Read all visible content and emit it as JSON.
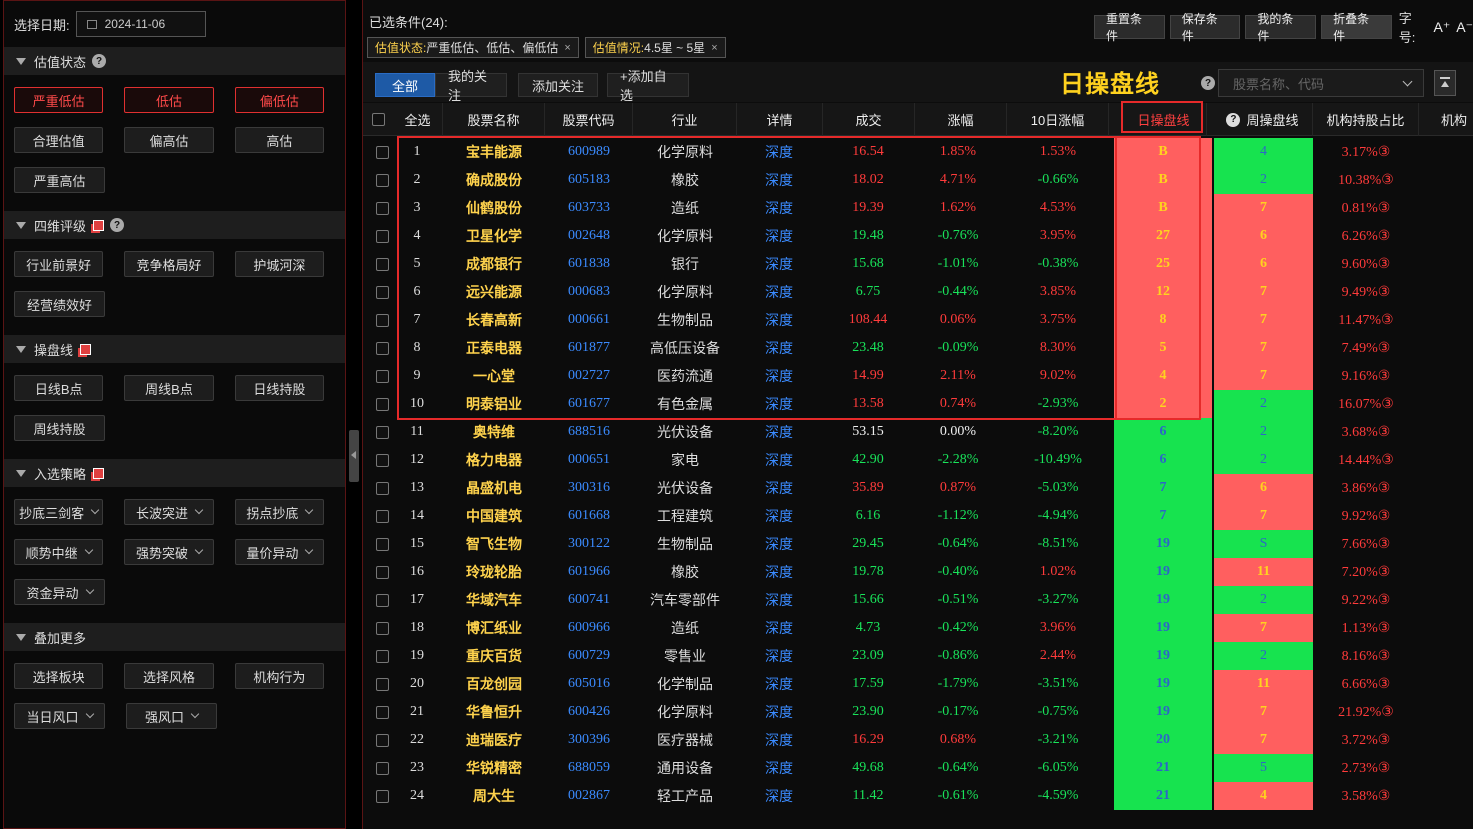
{
  "left": {
    "date_label": "选择日期:",
    "date_value": "2024-11-06",
    "sections": [
      {
        "title": "估值状态",
        "icons": [
          "help-icon"
        ],
        "rows": [
          [
            {
              "label": "严重低估",
              "selected": true
            },
            {
              "label": "低估",
              "selected": true
            },
            {
              "label": "偏低估",
              "selected": true
            }
          ],
          [
            {
              "label": "合理估值"
            },
            {
              "label": "偏高估"
            },
            {
              "label": "高估"
            }
          ],
          [
            {
              "label": "严重高估"
            }
          ]
        ]
      },
      {
        "title": "四维评级",
        "icons": [
          "copy-icon",
          "help-icon"
        ],
        "rows": [
          [
            {
              "label": "行业前景好"
            },
            {
              "label": "竞争格局好"
            },
            {
              "label": "护城河深"
            }
          ],
          [
            {
              "label": "经营绩效好"
            }
          ]
        ]
      },
      {
        "title": "操盘线",
        "icons": [
          "copy-icon"
        ],
        "rows": [
          [
            {
              "label": "日线B点"
            },
            {
              "label": "周线B点"
            },
            {
              "label": "日线持股"
            }
          ],
          [
            {
              "label": "周线持股"
            }
          ]
        ]
      },
      {
        "title": "入选策略",
        "icons": [
          "copy-icon"
        ],
        "rows": [
          [
            {
              "label": "抄底三剑客",
              "dropdown": true
            },
            {
              "label": "长波突进",
              "dropdown": true
            },
            {
              "label": "拐点抄底",
              "dropdown": true
            }
          ],
          [
            {
              "label": "顺势中继",
              "dropdown": true
            },
            {
              "label": "强势突破",
              "dropdown": true
            },
            {
              "label": "量价异动",
              "dropdown": true
            }
          ],
          [
            {
              "label": "资金异动",
              "dropdown": true
            }
          ]
        ]
      },
      {
        "title": "叠加更多",
        "icons": [],
        "rows": [
          [
            {
              "label": "选择板块"
            },
            {
              "label": "选择风格"
            },
            {
              "label": "机构行为"
            }
          ],
          [
            {
              "label": "当日风口",
              "dropdown": true
            },
            {
              "label": "强风口",
              "dropdown": true
            }
          ]
        ]
      }
    ]
  },
  "top": {
    "cond_title": "已选条件(24):",
    "buttons": [
      "重置条件",
      "保存条件",
      "我的条件",
      "折叠条件"
    ],
    "font_label": "字号:",
    "font_inc": "A⁺",
    "font_dec": "A⁻",
    "tags": [
      {
        "key": "估值状态:",
        "value": "严重低估、低估、偏低估",
        "close": "×"
      },
      {
        "key": "估值情况:",
        "value": "4.5星 ~ 5星",
        "close": "×"
      }
    ]
  },
  "tabs": [
    "全部",
    "我的关注",
    "添加关注",
    "+添加自选"
  ],
  "big_label": "日操盘线",
  "search_placeholder": "股票名称、代码",
  "columns": [
    "全选",
    "股票名称",
    "股票代码",
    "行业",
    "详情",
    "成交",
    "涨幅",
    "10日涨幅",
    "日操盘线",
    "周操盘线",
    "机构持股占比",
    "机构"
  ],
  "rows": [
    {
      "idx": "1",
      "name": "宝丰能源",
      "code": "600989",
      "industry": "化学原料",
      "detail": "深度",
      "vol": "16.54",
      "chg": "1.85%",
      "chg10": "1.53%",
      "day": "B",
      "week": "4",
      "inst": "3.17%③"
    },
    {
      "idx": "2",
      "name": "确成股份",
      "code": "605183",
      "industry": "橡胶",
      "detail": "深度",
      "vol": "18.02",
      "chg": "4.71%",
      "chg10": "-0.66%",
      "day": "B",
      "week": "2",
      "inst": "10.38%③"
    },
    {
      "idx": "3",
      "name": "仙鹤股份",
      "code": "603733",
      "industry": "造纸",
      "detail": "深度",
      "vol": "19.39",
      "chg": "1.62%",
      "chg10": "4.53%",
      "day": "B",
      "week": "7",
      "inst": "0.81%③"
    },
    {
      "idx": "4",
      "name": "卫星化学",
      "code": "002648",
      "industry": "化学原料",
      "detail": "深度",
      "vol": "19.48",
      "chg": "-0.76%",
      "chg10": "3.95%",
      "day": "27",
      "week": "6",
      "inst": "6.26%③"
    },
    {
      "idx": "5",
      "name": "成都银行",
      "code": "601838",
      "industry": "银行",
      "detail": "深度",
      "vol": "15.68",
      "chg": "-1.01%",
      "chg10": "-0.38%",
      "day": "25",
      "week": "6",
      "inst": "9.60%③"
    },
    {
      "idx": "6",
      "name": "远兴能源",
      "code": "000683",
      "industry": "化学原料",
      "detail": "深度",
      "vol": "6.75",
      "chg": "-0.44%",
      "chg10": "3.85%",
      "day": "12",
      "week": "7",
      "inst": "9.49%③"
    },
    {
      "idx": "7",
      "name": "长春高新",
      "code": "000661",
      "industry": "生物制品",
      "detail": "深度",
      "vol": "108.44",
      "chg": "0.06%",
      "chg10": "3.75%",
      "day": "8",
      "week": "7",
      "inst": "11.47%③"
    },
    {
      "idx": "8",
      "name": "正泰电器",
      "code": "601877",
      "industry": "高低压设备",
      "detail": "深度",
      "vol": "23.48",
      "chg": "-0.09%",
      "chg10": "8.30%",
      "day": "5",
      "week": "7",
      "inst": "7.49%③"
    },
    {
      "idx": "9",
      "name": "一心堂",
      "code": "002727",
      "industry": "医药流通",
      "detail": "深度",
      "vol": "14.99",
      "chg": "2.11%",
      "chg10": "9.02%",
      "day": "4",
      "week": "7",
      "inst": "9.16%③"
    },
    {
      "idx": "10",
      "name": "明泰铝业",
      "code": "601677",
      "industry": "有色金属",
      "detail": "深度",
      "vol": "13.58",
      "chg": "0.74%",
      "chg10": "-2.93%",
      "day": "2",
      "week": "2",
      "inst": "16.07%③"
    },
    {
      "idx": "11",
      "name": "奥特维",
      "code": "688516",
      "industry": "光伏设备",
      "detail": "深度",
      "vol": "53.15",
      "chg": "0.00%",
      "chg10": "-8.20%",
      "day": "6",
      "week": "2",
      "inst": "3.68%③"
    },
    {
      "idx": "12",
      "name": "格力电器",
      "code": "000651",
      "industry": "家电",
      "detail": "深度",
      "vol": "42.90",
      "chg": "-2.28%",
      "chg10": "-10.49%",
      "day": "6",
      "week": "2",
      "inst": "14.44%③"
    },
    {
      "idx": "13",
      "name": "晶盛机电",
      "code": "300316",
      "industry": "光伏设备",
      "detail": "深度",
      "vol": "35.89",
      "chg": "0.87%",
      "chg10": "-5.03%",
      "day": "7",
      "week": "6",
      "inst": "3.86%③"
    },
    {
      "idx": "14",
      "name": "中国建筑",
      "code": "601668",
      "industry": "工程建筑",
      "detail": "深度",
      "vol": "6.16",
      "chg": "-1.12%",
      "chg10": "-4.94%",
      "day": "7",
      "week": "7",
      "inst": "9.92%③"
    },
    {
      "idx": "15",
      "name": "智飞生物",
      "code": "300122",
      "industry": "生物制品",
      "detail": "深度",
      "vol": "29.45",
      "chg": "-0.64%",
      "chg10": "-8.51%",
      "day": "19",
      "week": "S",
      "inst": "7.66%③"
    },
    {
      "idx": "16",
      "name": "玲珑轮胎",
      "code": "601966",
      "industry": "橡胶",
      "detail": "深度",
      "vol": "19.78",
      "chg": "-0.40%",
      "chg10": "1.02%",
      "day": "19",
      "week": "11",
      "inst": "7.20%③"
    },
    {
      "idx": "17",
      "name": "华域汽车",
      "code": "600741",
      "industry": "汽车零部件",
      "detail": "深度",
      "vol": "15.66",
      "chg": "-0.51%",
      "chg10": "-3.27%",
      "day": "19",
      "week": "2",
      "inst": "9.22%③"
    },
    {
      "idx": "18",
      "name": "博汇纸业",
      "code": "600966",
      "industry": "造纸",
      "detail": "深度",
      "vol": "4.73",
      "chg": "-0.42%",
      "chg10": "3.96%",
      "day": "19",
      "week": "7",
      "inst": "1.13%③"
    },
    {
      "idx": "19",
      "name": "重庆百货",
      "code": "600729",
      "industry": "零售业",
      "detail": "深度",
      "vol": "23.09",
      "chg": "-0.86%",
      "chg10": "2.44%",
      "day": "19",
      "week": "2",
      "inst": "8.16%③"
    },
    {
      "idx": "20",
      "name": "百龙创园",
      "code": "605016",
      "industry": "化学制品",
      "detail": "深度",
      "vol": "17.59",
      "chg": "-1.79%",
      "chg10": "-3.51%",
      "day": "19",
      "week": "11",
      "inst": "6.66%③"
    },
    {
      "idx": "21",
      "name": "华鲁恒升",
      "code": "600426",
      "industry": "化学原料",
      "detail": "深度",
      "vol": "23.90",
      "chg": "-0.17%",
      "chg10": "-0.75%",
      "day": "19",
      "week": "7",
      "inst": "21.92%③"
    },
    {
      "idx": "22",
      "name": "迪瑞医疗",
      "code": "300396",
      "industry": "医疗器械",
      "detail": "深度",
      "vol": "16.29",
      "chg": "0.68%",
      "chg10": "-3.21%",
      "day": "20",
      "week": "7",
      "inst": "3.72%③"
    },
    {
      "idx": "23",
      "name": "华锐精密",
      "code": "688059",
      "industry": "通用设备",
      "detail": "深度",
      "vol": "49.68",
      "chg": "-0.64%",
      "chg10": "-6.05%",
      "day": "21",
      "week": "5",
      "inst": "2.73%③"
    },
    {
      "idx": "24",
      "name": "周大生",
      "code": "002867",
      "industry": "轻工产品",
      "detail": "深度",
      "vol": "11.42",
      "chg": "-0.61%",
      "chg10": "-4.59%",
      "day": "21",
      "week": "4",
      "inst": "3.58%③"
    }
  ],
  "row_colors": {
    "day_red_rows": [
      1,
      2,
      3,
      4,
      5,
      6,
      7,
      8,
      9,
      10
    ],
    "week_red_rows": [
      3,
      4,
      5,
      6,
      7,
      8,
      9,
      13,
      14,
      16,
      18,
      20,
      21,
      22,
      24
    ],
    "accent_red": "#ff5f5f",
    "accent_green": "#17e34f",
    "tab_blue": "#1e5aa6",
    "label_yellow": "#ffd21f"
  }
}
